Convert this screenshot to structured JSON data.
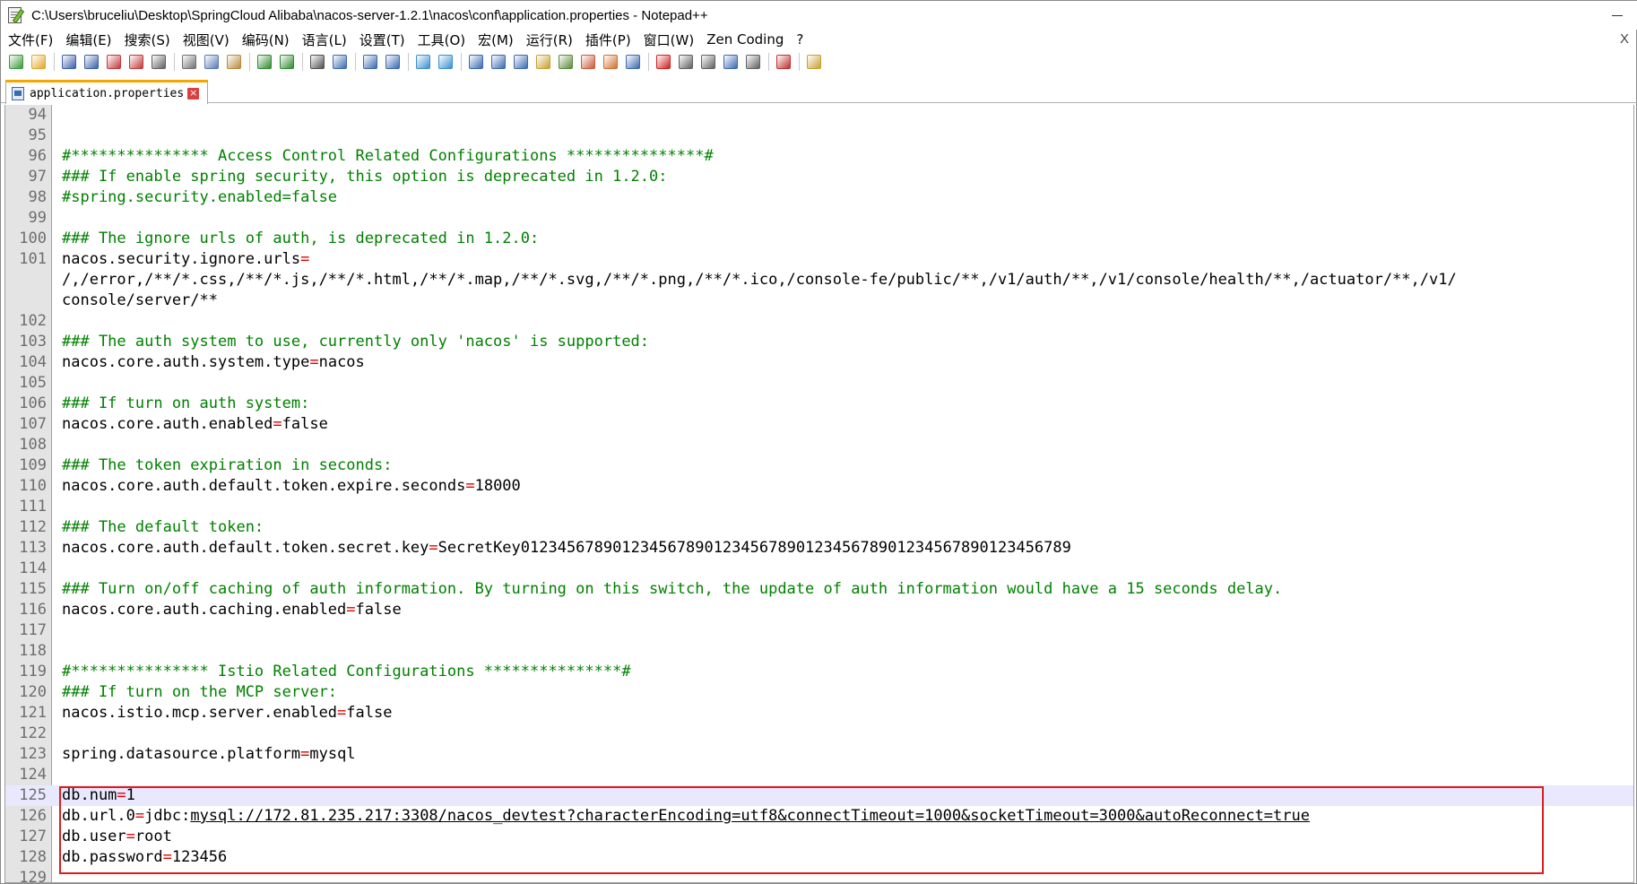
{
  "window": {
    "title": "C:\\Users\\bruceliu\\Desktop\\SpringCloud Alibaba\\nacos-server-1.2.1\\nacos\\conf\\application.properties - Notepad++"
  },
  "menu": {
    "items": [
      "文件(F)",
      "编辑(E)",
      "搜索(S)",
      "视图(V)",
      "编码(N)",
      "语言(L)",
      "设置(T)",
      "工具(O)",
      "宏(M)",
      "运行(R)",
      "插件(P)",
      "窗口(W)",
      "Zen Coding",
      "?"
    ],
    "close_glyph": "X"
  },
  "toolbar": {
    "icons": [
      "new-file-icon",
      "open-file-icon",
      "save-icon",
      "save-all-icon",
      "close-icon",
      "close-all-icon",
      "print-icon",
      "cut-icon",
      "copy-icon",
      "paste-icon",
      "undo-icon",
      "redo-icon",
      "find-icon",
      "replace-icon",
      "zoom-in-icon",
      "zoom-out-icon",
      "sync-vertical-icon",
      "sync-horizontal-icon",
      "word-wrap-icon",
      "show-all-chars-icon",
      "indent-guide-icon",
      "user-lang-icon",
      "doc-map-icon",
      "function-list-icon",
      "folder-workspace-icon",
      "monitor-icon",
      "record-macro-icon",
      "stop-macro-icon",
      "play-macro-icon",
      "run-macro-multiple-icon",
      "save-macro-icon",
      "spellcheck-icon",
      "plugin-icon"
    ],
    "colors": [
      "#3a9a3a",
      "#e2a72c",
      "#3a5fa8",
      "#3a5fa8",
      "#c23a3a",
      "#c23a3a",
      "#606060",
      "#707070",
      "#5a7ab8",
      "#b88a3a",
      "#2e8b2e",
      "#2e8b2e",
      "#505050",
      "#3a6ab0",
      "#3a6ab0",
      "#3a6ab0",
      "#3a8fd0",
      "#3a8fd0",
      "#3a6ab0",
      "#3a6ab0",
      "#3a6ab0",
      "#c8a030",
      "#5a8a3a",
      "#c85a3a",
      "#d07030",
      "#3a6ab0",
      "#d02020",
      "#606060",
      "#606060",
      "#3a6ab0",
      "#606060",
      "#c03030",
      "#c8a030"
    ]
  },
  "tab": {
    "label": "application.properties",
    "close_glyph": "×"
  },
  "editor": {
    "lines": [
      {
        "n": "94",
        "parts": []
      },
      {
        "n": "95",
        "parts": []
      },
      {
        "n": "96",
        "parts": [
          {
            "t": "#*************** Access Control Related Configurations ***************#",
            "c": "cmt"
          }
        ]
      },
      {
        "n": "97",
        "parts": [
          {
            "t": "### If enable spring security, this option is deprecated in 1.2.0:",
            "c": "cmt"
          }
        ]
      },
      {
        "n": "98",
        "parts": [
          {
            "t": "#spring.security.enabled=false",
            "c": "cmt"
          }
        ]
      },
      {
        "n": "99",
        "parts": []
      },
      {
        "n": "100",
        "parts": [
          {
            "t": "### The ignore urls of auth, is deprecated in 1.2.0:",
            "c": "cmt"
          }
        ]
      },
      {
        "n": "101",
        "parts": [
          {
            "t": "nacos.security.ignore.urls",
            "c": ""
          },
          {
            "t": "=",
            "c": "eq"
          }
        ]
      },
      {
        "n": "",
        "parts": [
          {
            "t": "/,/error,/**/*.css,/**/*.js,/**/*.html,/**/*.map,/**/*.svg,/**/*.png,/**/*.ico,/console-fe/public/**,/v1/auth/**,/v1/console/health/**,/actuator/**,/v1/",
            "c": ""
          }
        ]
      },
      {
        "n": "",
        "parts": [
          {
            "t": "console/server/**",
            "c": ""
          }
        ]
      },
      {
        "n": "102",
        "parts": []
      },
      {
        "n": "103",
        "parts": [
          {
            "t": "### The auth system to use, currently only 'nacos' is supported:",
            "c": "cmt"
          }
        ]
      },
      {
        "n": "104",
        "parts": [
          {
            "t": "nacos.core.auth.system.type",
            "c": ""
          },
          {
            "t": "=",
            "c": "eq"
          },
          {
            "t": "nacos",
            "c": ""
          }
        ]
      },
      {
        "n": "105",
        "parts": []
      },
      {
        "n": "106",
        "parts": [
          {
            "t": "### If turn on auth system:",
            "c": "cmt"
          }
        ]
      },
      {
        "n": "107",
        "parts": [
          {
            "t": "nacos.core.auth.enabled",
            "c": ""
          },
          {
            "t": "=",
            "c": "eq"
          },
          {
            "t": "false",
            "c": ""
          }
        ]
      },
      {
        "n": "108",
        "parts": []
      },
      {
        "n": "109",
        "parts": [
          {
            "t": "### The token expiration in seconds:",
            "c": "cmt"
          }
        ]
      },
      {
        "n": "110",
        "parts": [
          {
            "t": "nacos.core.auth.default.token.expire.seconds",
            "c": ""
          },
          {
            "t": "=",
            "c": "eq"
          },
          {
            "t": "18000",
            "c": ""
          }
        ]
      },
      {
        "n": "111",
        "parts": []
      },
      {
        "n": "112",
        "parts": [
          {
            "t": "### The default token:",
            "c": "cmt"
          }
        ]
      },
      {
        "n": "113",
        "parts": [
          {
            "t": "nacos.core.auth.default.token.secret.key",
            "c": ""
          },
          {
            "t": "=",
            "c": "eq"
          },
          {
            "t": "SecretKey012345678901234567890123456789012345678901234567890123456789",
            "c": ""
          }
        ]
      },
      {
        "n": "114",
        "parts": []
      },
      {
        "n": "115",
        "parts": [
          {
            "t": "### Turn on/off caching of auth information. By turning on this switch, the update of auth information would have a 15 seconds delay.",
            "c": "cmt"
          }
        ]
      },
      {
        "n": "116",
        "parts": [
          {
            "t": "nacos.core.auth.caching.enabled",
            "c": ""
          },
          {
            "t": "=",
            "c": "eq"
          },
          {
            "t": "false",
            "c": ""
          }
        ]
      },
      {
        "n": "117",
        "parts": []
      },
      {
        "n": "118",
        "parts": []
      },
      {
        "n": "119",
        "parts": [
          {
            "t": "#*************** Istio Related Configurations ***************#",
            "c": "cmt"
          }
        ]
      },
      {
        "n": "120",
        "parts": [
          {
            "t": "### If turn on the MCP server:",
            "c": "cmt"
          }
        ]
      },
      {
        "n": "121",
        "parts": [
          {
            "t": "nacos.istio.mcp.server.enabled",
            "c": ""
          },
          {
            "t": "=",
            "c": "eq"
          },
          {
            "t": "false",
            "c": ""
          }
        ]
      },
      {
        "n": "122",
        "parts": []
      },
      {
        "n": "123",
        "parts": [
          {
            "t": "spring.datasource.platform",
            "c": ""
          },
          {
            "t": "=",
            "c": "eq"
          },
          {
            "t": "mysql",
            "c": ""
          }
        ]
      },
      {
        "n": "124",
        "parts": []
      },
      {
        "n": "125",
        "parts": [
          {
            "t": "db.num",
            "c": ""
          },
          {
            "t": "=",
            "c": "eq"
          },
          {
            "t": "1",
            "c": ""
          }
        ],
        "highlight": true
      },
      {
        "n": "126",
        "parts": [
          {
            "t": "db.url.0",
            "c": ""
          },
          {
            "t": "=",
            "c": "eq"
          },
          {
            "t": "jdbc:",
            "c": ""
          },
          {
            "t": "mysql://172.81.235.217:3308/nacos_devtest?characterEncoding=utf8&connectTimeout=1000&socketTimeout=3000&autoReconnect=true",
            "c": "uline"
          }
        ]
      },
      {
        "n": "127",
        "parts": [
          {
            "t": "db.user",
            "c": ""
          },
          {
            "t": "=",
            "c": "eq"
          },
          {
            "t": "root",
            "c": ""
          }
        ]
      },
      {
        "n": "128",
        "parts": [
          {
            "t": "db.password",
            "c": ""
          },
          {
            "t": "=",
            "c": "eq"
          },
          {
            "t": "123456",
            "c": ""
          }
        ]
      },
      {
        "n": "129",
        "parts": []
      }
    ]
  }
}
